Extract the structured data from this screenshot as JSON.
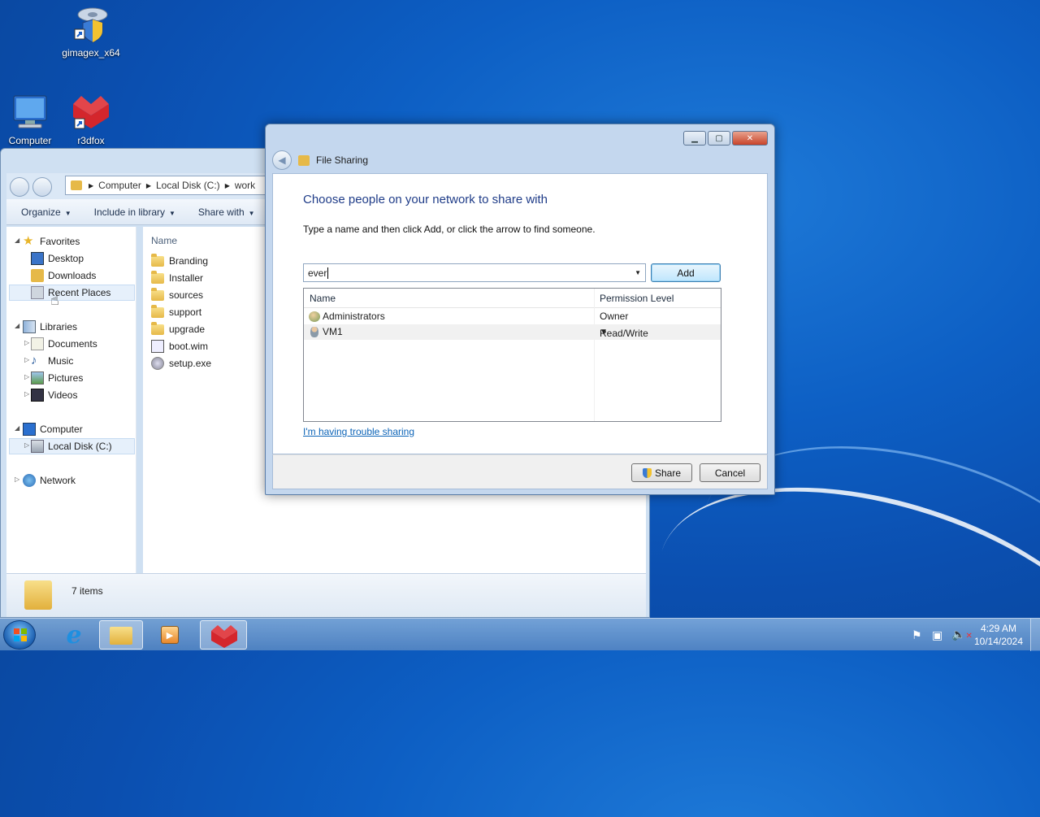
{
  "desktop": {
    "icons": [
      {
        "label": "gimagex_x64"
      },
      {
        "label": "Computer"
      },
      {
        "label": "r3dfox"
      }
    ]
  },
  "explorer": {
    "address": {
      "segments": [
        "Computer",
        "Local Disk (C:)",
        "work"
      ]
    },
    "toolbar": {
      "organize": "Organize",
      "include": "Include in library",
      "share": "Share with"
    },
    "nav": {
      "favorites": "Favorites",
      "desktop": "Desktop",
      "downloads": "Downloads",
      "recent": "Recent Places",
      "libraries": "Libraries",
      "documents": "Documents",
      "music": "Music",
      "pictures": "Pictures",
      "videos": "Videos",
      "computer": "Computer",
      "localdisk": "Local Disk (C:)",
      "network": "Network"
    },
    "column_name": "Name",
    "files": [
      "Branding",
      "Installer",
      "sources",
      "support",
      "upgrade",
      "boot.wim",
      "setup.exe"
    ],
    "status": "7 items"
  },
  "dialog": {
    "title": "File Sharing",
    "heading": "Choose people on your network to share with",
    "instruction": "Type a name and then click Add, or click the arrow to find someone.",
    "input_value": "ever",
    "add_label": "Add",
    "columns": {
      "name": "Name",
      "permission": "Permission Level"
    },
    "rows": [
      {
        "name": "Administrators",
        "permission": "Owner"
      },
      {
        "name": "VM1",
        "permission": "Read/Write"
      }
    ],
    "trouble_link": "I'm having trouble sharing",
    "share_label": "Share",
    "cancel_label": "Cancel"
  },
  "taskbar": {
    "time": "4:29 AM",
    "date": "10/14/2024"
  }
}
